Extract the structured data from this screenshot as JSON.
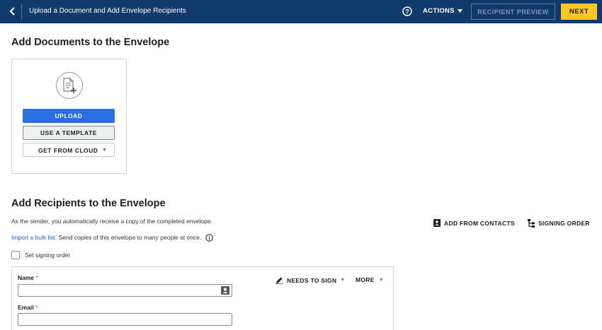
{
  "topbar": {
    "title": "Upload a Document and Add Envelope Recipients",
    "actions_label": "ACTIONS",
    "preview_label": "RECIPIENT PREVIEW",
    "next_label": "NEXT",
    "bg_color": "#103a6a",
    "next_color": "#ffc820"
  },
  "documents": {
    "heading": "Add Documents to the Envelope",
    "upload_label": "UPLOAD",
    "template_label": "USE A TEMPLATE",
    "cloud_label": "GET FROM CLOUD",
    "upload_color": "#2c6fe0"
  },
  "recipients": {
    "heading": "Add Recipients to the Envelope",
    "sender_note": "As the sender, you automatically receive a copy of the completed envelope.",
    "bulk_link": "Import a bulk list.",
    "bulk_note": " Send copies of this envelope to many people at once.",
    "add_contacts_label": "ADD FROM CONTACTS",
    "signing_order_label": "SIGNING ORDER",
    "set_order_label": "Set signing order",
    "card": {
      "name_label": "Name",
      "email_label": "Email",
      "required_mark": "*",
      "role_label": "NEEDS TO SIGN",
      "more_label": "MORE",
      "name_value": "",
      "email_value": ""
    }
  }
}
